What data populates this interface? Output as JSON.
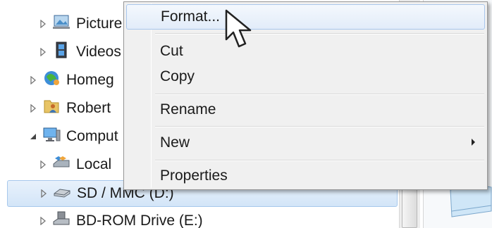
{
  "tree": {
    "items": [
      {
        "label": "Picture",
        "icon": "pictures-library-icon",
        "expanded": false
      },
      {
        "label": "Videos",
        "icon": "videos-library-icon",
        "expanded": false
      },
      {
        "label": "Homeg",
        "icon": "homegroup-icon",
        "expanded": false
      },
      {
        "label": "Robert",
        "icon": "user-folder-icon",
        "expanded": false
      },
      {
        "label": "Comput",
        "icon": "computer-icon",
        "expanded": true
      },
      {
        "label": "Local",
        "icon": "local-disk-icon",
        "expanded": false
      },
      {
        "label": "SD / MMC (D:)",
        "icon": "removable-drive-icon",
        "expanded": false,
        "selected": true
      },
      {
        "label": "BD-ROM Drive (E:)",
        "icon": "bd-rom-drive-icon",
        "expanded": false
      }
    ]
  },
  "context_menu": {
    "items": [
      {
        "label": "Format...",
        "highlighted": true
      },
      {
        "label": "Cut"
      },
      {
        "label": "Copy"
      },
      {
        "label": "Rename"
      },
      {
        "label": "New",
        "has_submenu": true
      },
      {
        "label": "Properties"
      }
    ]
  },
  "colors": {
    "selection_fill": "#d3e5f8",
    "selection_border": "#a7c8ec",
    "menu_background": "#f0f0f0"
  }
}
